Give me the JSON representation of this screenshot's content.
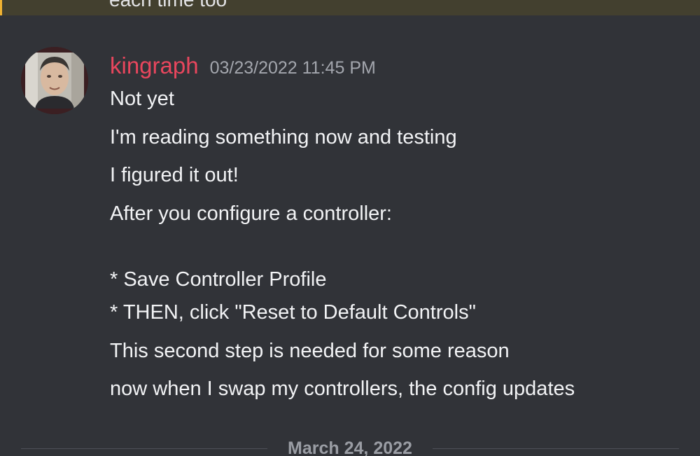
{
  "previous_message": {
    "text": "each time too"
  },
  "message": {
    "username": "kingraph",
    "timestamp": "03/23/2022 11:45 PM",
    "username_color": "#e8465d",
    "lines": [
      "Not yet",
      "I'm reading something now and testing",
      "I figured it out!",
      "After you configure a controller:",
      "* Save Controller Profile",
      "* THEN, click \"Reset to Default Controls\"",
      "This second step is needed for some reason",
      "now when I swap my controllers, the config updates"
    ]
  },
  "date_divider": {
    "label": "March 24, 2022"
  },
  "colors": {
    "background": "#313338",
    "highlight_background": "#43402f",
    "highlight_border": "#f0b232",
    "text": "#f2f3f5",
    "timestamp": "#a3a6ad"
  }
}
